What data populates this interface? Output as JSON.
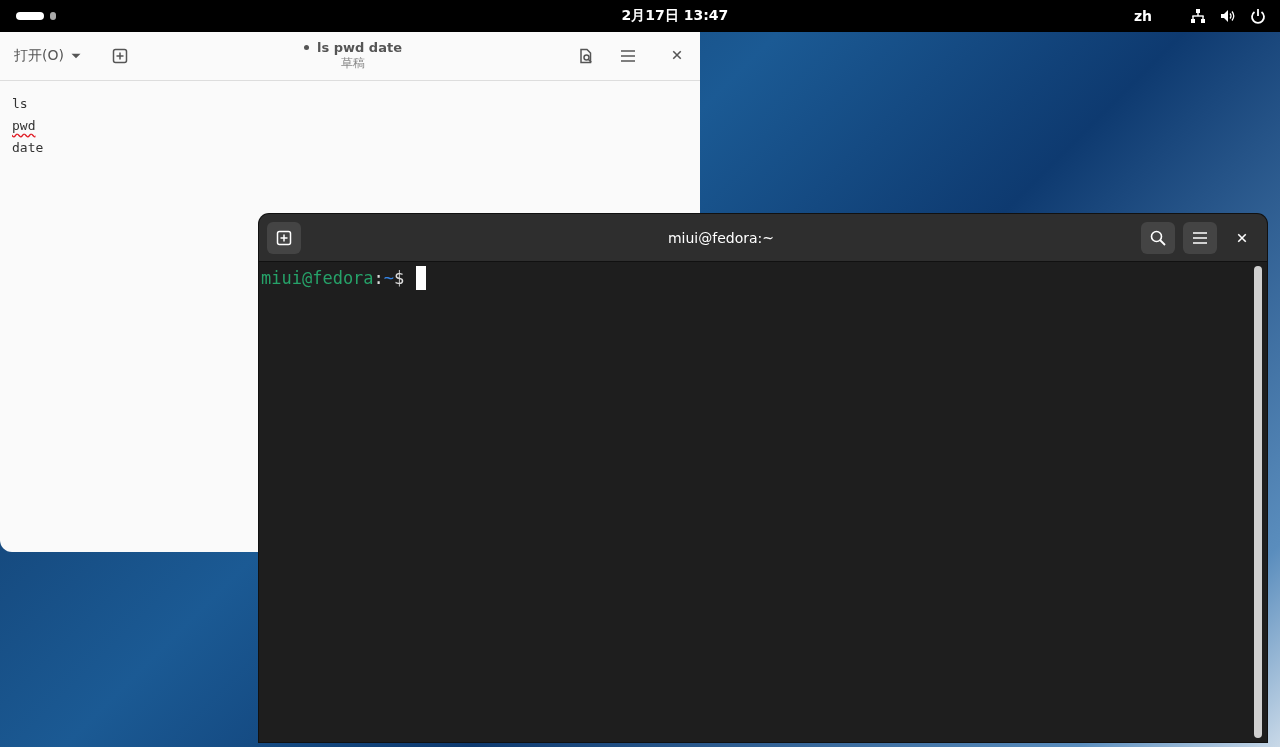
{
  "top_bar": {
    "workspaces": [
      {
        "selected": true
      },
      {
        "selected": false
      }
    ],
    "clock": "2月17日 13:47",
    "input_method": "zh"
  },
  "editor": {
    "open_button": "打开(O)",
    "modified": true,
    "title": "ls pwd date",
    "subtitle": "草稿",
    "lines": [
      {
        "text": "ls",
        "misspelled": false
      },
      {
        "text": "pwd",
        "misspelled": true
      },
      {
        "text": "date",
        "misspelled": false
      }
    ]
  },
  "terminal": {
    "title": "miui@fedora:~",
    "prompt": [
      {
        "kind": "user",
        "text": "miui@fedora"
      },
      {
        "kind": "sep",
        "text": ":"
      },
      {
        "kind": "path",
        "text": "~"
      },
      {
        "kind": "sigil",
        "text": "$"
      }
    ]
  }
}
